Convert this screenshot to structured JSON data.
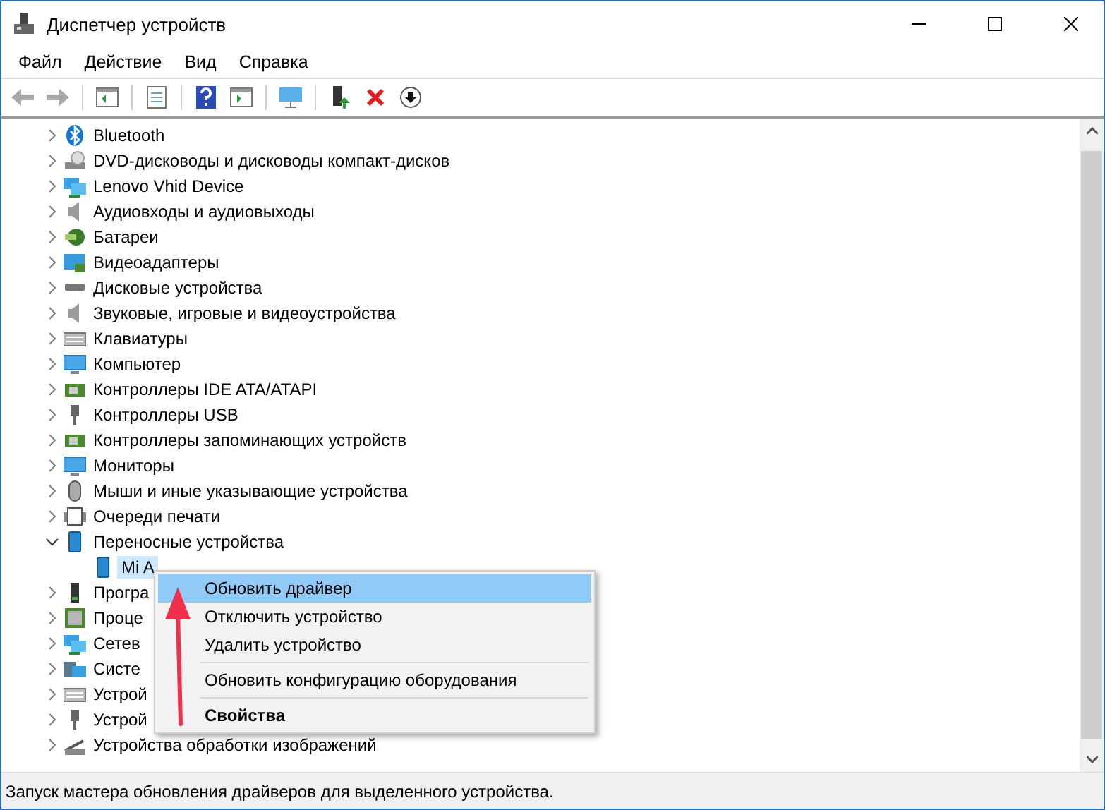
{
  "window": {
    "title": "Диспетчер устройств"
  },
  "menu_bar": [
    "Файл",
    "Действие",
    "Вид",
    "Справка"
  ],
  "toolbar": [
    {
      "kind": "back",
      "disabled": true
    },
    {
      "kind": "forward",
      "disabled": true
    },
    {
      "kind": "separator"
    },
    {
      "kind": "console",
      "disabled": false
    },
    {
      "kind": "separator"
    },
    {
      "kind": "properties",
      "disabled": false
    },
    {
      "kind": "separator"
    },
    {
      "kind": "help",
      "disabled": false
    },
    {
      "kind": "view",
      "disabled": false
    },
    {
      "kind": "separator"
    },
    {
      "kind": "scan",
      "disabled": false
    },
    {
      "kind": "separator"
    },
    {
      "kind": "update",
      "disabled": false
    },
    {
      "kind": "remove",
      "disabled": false
    },
    {
      "kind": "disable",
      "disabled": false
    }
  ],
  "tree": [
    {
      "label": "Bluetooth",
      "kind": "bluetooth",
      "expanded": false
    },
    {
      "label": "DVD-дисководы и дисководы компакт-дисков",
      "kind": "dvd",
      "expanded": false
    },
    {
      "label": "Lenovo Vhid Device",
      "kind": "network",
      "expanded": false
    },
    {
      "label": "Аудиовходы и аудиовыходы",
      "kind": "speaker",
      "expanded": false
    },
    {
      "label": "Батареи",
      "kind": "battery",
      "expanded": false
    },
    {
      "label": "Видеоадаптеры",
      "kind": "display",
      "expanded": false
    },
    {
      "label": "Дисковые устройства",
      "kind": "disk",
      "expanded": false
    },
    {
      "label": "Звуковые, игровые и видеоустройства",
      "kind": "speaker",
      "expanded": false
    },
    {
      "label": "Клавиатуры",
      "kind": "keyboard",
      "expanded": false
    },
    {
      "label": "Компьютер",
      "kind": "monitor",
      "expanded": false
    },
    {
      "label": "Контроллеры IDE ATA/ATAPI",
      "kind": "chip",
      "expanded": false
    },
    {
      "label": "Контроллеры USB",
      "kind": "usb",
      "expanded": false
    },
    {
      "label": "Контроллеры запоминающих устройств",
      "kind": "chip",
      "expanded": false
    },
    {
      "label": "Мониторы",
      "kind": "monitor",
      "expanded": false
    },
    {
      "label": "Мыши и иные указывающие устройства",
      "kind": "mouse",
      "expanded": false
    },
    {
      "label": "Очереди печати",
      "kind": "printer",
      "expanded": false
    },
    {
      "label": "Переносные устройства",
      "kind": "phone",
      "expanded": true,
      "children": [
        {
          "label": "Mi A",
          "kind": "phone",
          "selected": true
        }
      ]
    },
    {
      "label": "Програ",
      "kind": "tower",
      "expanded": false
    },
    {
      "label": "Проце",
      "kind": "cpu",
      "expanded": false
    },
    {
      "label": "Сетев",
      "kind": "network",
      "expanded": false
    },
    {
      "label": "Систе",
      "kind": "folder",
      "expanded": false
    },
    {
      "label": "Устрой",
      "kind": "keyboard",
      "expanded": false
    },
    {
      "label": "Устрой",
      "kind": "usb",
      "expanded": false
    },
    {
      "label": "Устройства обработки изображений",
      "kind": "scanner",
      "expanded": false
    }
  ],
  "context_menu": [
    {
      "kind": "item",
      "label": "Обновить драйвер",
      "selected": true,
      "default": false
    },
    {
      "kind": "item",
      "label": "Отключить устройство",
      "selected": false,
      "default": false
    },
    {
      "kind": "item",
      "label": "Удалить устройство",
      "selected": false,
      "default": false
    },
    {
      "kind": "separator"
    },
    {
      "kind": "item",
      "label": "Обновить конфигурацию оборудования",
      "selected": false,
      "default": false
    },
    {
      "kind": "separator"
    },
    {
      "kind": "item",
      "label": "Свойства",
      "selected": false,
      "default": true
    }
  ],
  "status_bar": "Запуск мастера обновления драйверов для выделенного устройства."
}
